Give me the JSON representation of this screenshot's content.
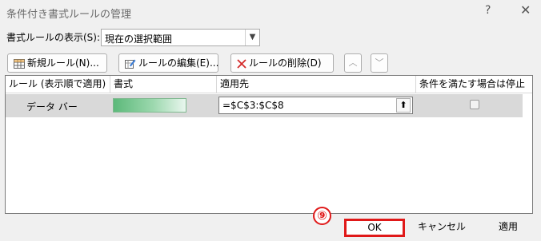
{
  "window": {
    "title": "条件付き書式ルールの管理",
    "help_label": "?",
    "close_label": "✕"
  },
  "show_rules": {
    "label": "書式ルールの表示(S):",
    "selected": "現在の選択範囲"
  },
  "toolbar": {
    "new_rule": "新規ルール(N)...",
    "edit_rule": "ルールの編集(E)...",
    "delete_rule": "ルールの削除(D)",
    "move_up": "︿",
    "move_down": "﹀"
  },
  "table": {
    "headers": [
      "ルール (表示順で適用)",
      "書式",
      "適用先",
      "条件を満たす場合は停止"
    ],
    "rows": [
      {
        "rule": "データ バー",
        "format_preview": "data-bar-green",
        "applies_to": "=$C$3:$C$8",
        "stop_if_true": false
      }
    ]
  },
  "colors": {
    "highlight": "#e01919",
    "databar": "#5cb97a"
  },
  "footer": {
    "step_marker": "⑨",
    "ok": "OK",
    "cancel": "キャンセル",
    "apply": "適用"
  }
}
